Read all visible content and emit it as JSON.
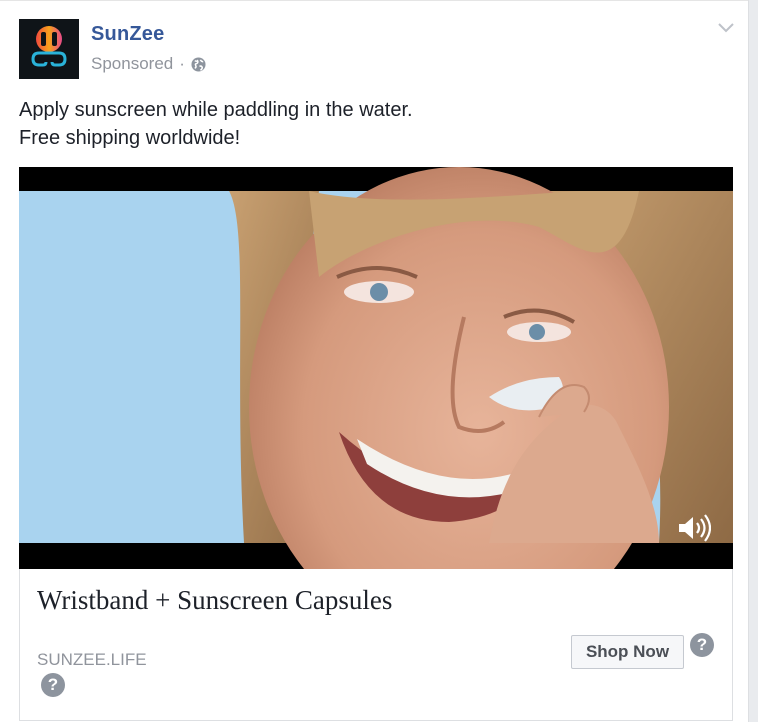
{
  "post": {
    "page_name": "SunZee",
    "sponsored_label": "Sponsored",
    "separator": "·",
    "text_line1": "Apply sunscreen while paddling in the water.",
    "text_line2": "Free shipping worldwide!"
  },
  "ad": {
    "headline": "Wristband + Sunscreen Capsules",
    "domain": "SUNZEE.LIFE",
    "cta_label": "Shop Now",
    "help_glyph": "?"
  },
  "colors": {
    "brand_blue": "#365899",
    "muted_text": "#90949c",
    "sky": "#a9d3ef"
  },
  "icons": [
    "logo-icon",
    "globe-icon",
    "chevron-down-icon",
    "volume-icon",
    "help-icon"
  ]
}
